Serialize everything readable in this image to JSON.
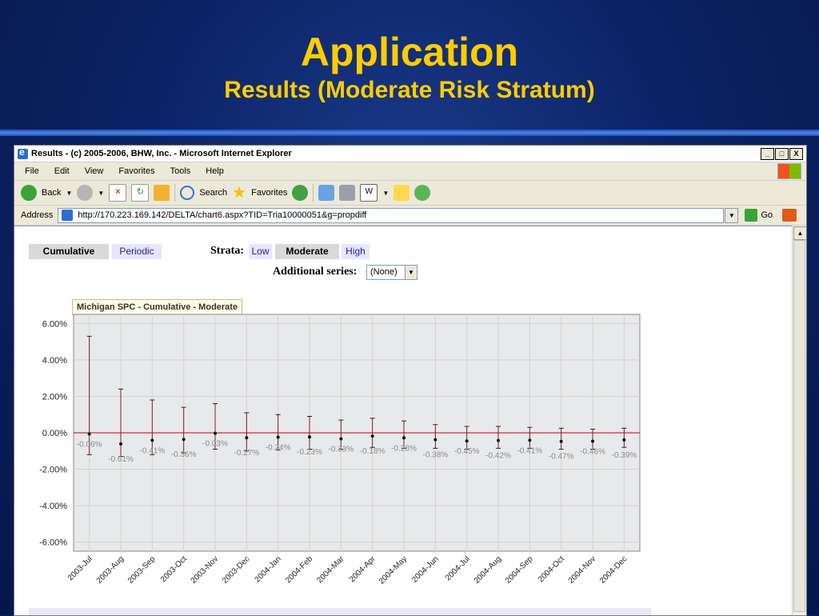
{
  "slide": {
    "title": "Application",
    "subtitle": "Results (Moderate Risk Stratum)"
  },
  "window": {
    "title": "Results - (c) 2005-2006, BHW, Inc. - Microsoft Internet Explorer",
    "controls": [
      "_",
      "□",
      "X"
    ]
  },
  "menu": [
    "File",
    "Edit",
    "View",
    "Favorites",
    "Tools",
    "Help"
  ],
  "toolbar": {
    "back_label": "Back",
    "search_label": "Search",
    "favorites_label": "Favorites"
  },
  "address": {
    "label": "Address",
    "url": "http://170.223.169.142/DELTA/chart6.aspx?TID=Tria10000051&g=propdiff",
    "go_label": "Go"
  },
  "page": {
    "tabs": [
      "Cumulative",
      "Periodic"
    ],
    "active_tab": "Cumulative",
    "strata_label": "Strata:",
    "strata_options": [
      "Low",
      "Moderate",
      "High"
    ],
    "active_stratum": "Moderate",
    "additional_label": "Additional series:",
    "additional_value": "(None)",
    "chart_tab": "Michigan SPC - Cumulative - Moderate"
  },
  "colors": {
    "background": "#0c2466",
    "title": "#ffcc00",
    "zero_line": "#cc0000",
    "error_bar": "#7a2030",
    "plot_bg": "#e8e9eb"
  },
  "chart_data": {
    "type": "scatter",
    "title": "",
    "categories": [
      "2003-Jul",
      "2003-Aug",
      "2003-Sep",
      "2003-Oct",
      "2003-Nov",
      "2003-Dec",
      "2004-Jan",
      "2004-Feb",
      "2004-Mar",
      "2004-Apr",
      "2004-May",
      "2004-Jun",
      "2004-Jul",
      "2004-Aug",
      "2004-Sep",
      "2004-Oct",
      "2004-Nov",
      "2004-Dec"
    ],
    "values": [
      -0.06,
      -0.61,
      -0.41,
      -0.36,
      -0.03,
      -0.27,
      -0.24,
      -0.23,
      -0.33,
      -0.18,
      -0.28,
      -0.38,
      -0.45,
      -0.42,
      -0.41,
      -0.47,
      -0.46,
      -0.39
    ],
    "value_labels": [
      "-0.06%",
      "-0.61%",
      "-0.41%",
      "-0.36%",
      "-0.03%",
      "-0.27%",
      "-0.24%",
      "-0.23%",
      "-0.33%",
      "-0.18%",
      "-0.28%",
      "-0.38%",
      "-0.45%",
      "-0.42%",
      "-0.41%",
      "-0.47%",
      "-0.46%",
      "-0.39%"
    ],
    "upper": [
      5.3,
      2.4,
      1.8,
      1.4,
      1.6,
      1.1,
      1.0,
      0.9,
      0.7,
      0.8,
      0.65,
      0.45,
      0.35,
      0.35,
      0.3,
      0.25,
      0.2,
      0.25
    ],
    "lower": [
      -1.2,
      -1.3,
      -1.2,
      -1.1,
      -0.9,
      -1.0,
      -0.95,
      -0.9,
      -0.9,
      -0.8,
      -0.85,
      -0.85,
      -0.9,
      -0.85,
      -0.85,
      -0.9,
      -0.9,
      -0.8
    ],
    "ylim": [
      -6.5,
      6.5
    ],
    "yticks": [
      "6.00%",
      "4.00%",
      "2.00%",
      "0.00%",
      "-2.00%",
      "-4.00%",
      "-6.00%"
    ],
    "ytick_values": [
      6,
      4,
      2,
      0,
      -2,
      -4,
      -6
    ],
    "grid": true
  }
}
